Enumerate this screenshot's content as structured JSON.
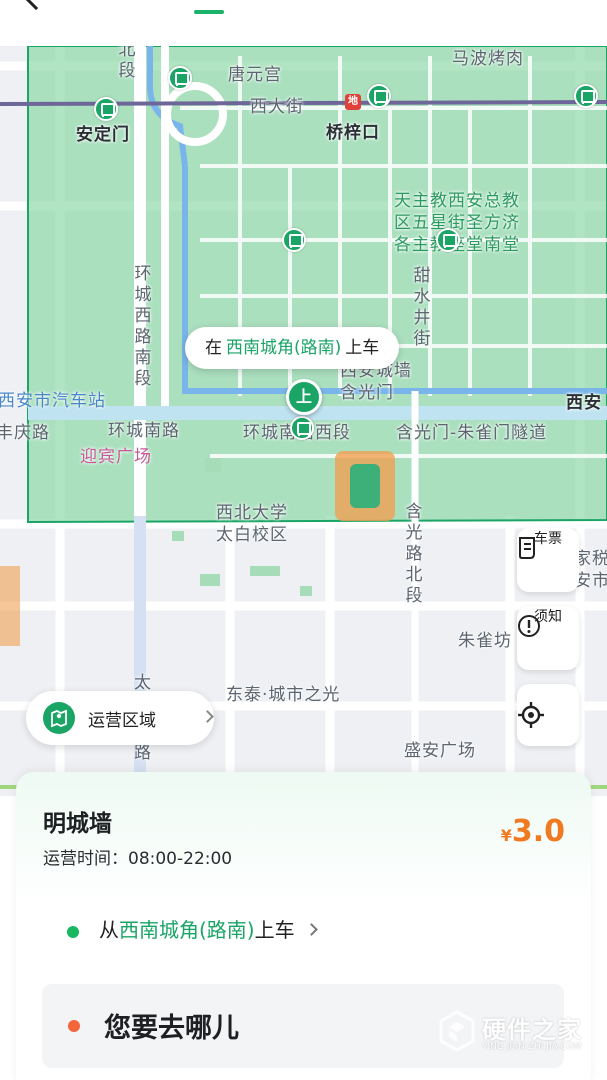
{
  "map": {
    "labels": {
      "bei_duan": "北段",
      "tang_yuan_gong": "唐元宫",
      "ma_bo_kao_rou": "马波烤肉",
      "xi_da_jie": "西大街",
      "an_ding_men": "安定门",
      "qiao_zi_kou": "桥梓口",
      "church_l1": "天主教西安总教",
      "church_l2": "区五星街圣方济",
      "church_l3": "各主教座堂南堂",
      "huan_cheng_xi_lu_nan_duan": "环城西路南段",
      "tian_shui_jing": "甜水井街",
      "xian_bus_station": "西安市汽车站",
      "feng_qing_lu": "丰庆路",
      "huan_cheng_nan_lu": "环城南路",
      "huan_cheng_nan_lu_xi_duan": "环城南路西段",
      "tunnel": "含光门-朱雀门隧道",
      "city_wall": "西安城墙",
      "han_guang_men": "含光门",
      "ying_bin_guang_chang": "迎宾广场",
      "nwu_l1": "西北大学",
      "nwu_l2": "太白校区",
      "han_guang_lu_bei_duan": "含光路北段",
      "zhu_que_fang": "朱雀坊",
      "dong_tai": "东泰·城市之光",
      "sheng_an": "盛安广场",
      "xi_an_right": "西安",
      "tax_right": "家税",
      "tax_right2": "安市",
      "tai": "太",
      "lu": "路"
    },
    "metro_glyph": "地",
    "boarding_bubble": {
      "prefix": "在",
      "station": "西南城角(路南)",
      "suffix": "上车"
    },
    "boarding_pin": "上",
    "controls": {
      "ticket_label": "车票",
      "notice_label": "须知",
      "ops_area_label": "运营区域"
    }
  },
  "sheet": {
    "route_title": "明城墙",
    "hours_label": "运营时间：",
    "hours_value": "08:00-22:00",
    "price_currency": "¥",
    "price_value": "3.0",
    "from_prefix": "从",
    "from_station": "西南城角(路南)",
    "from_suffix": "上车",
    "destination_placeholder": "您要去哪儿"
  },
  "watermark": {
    "main": "硬件之家",
    "sub": "YING JIAN ZHI JIA.COM"
  },
  "colors": {
    "brand_green": "#1aa466",
    "price_orange": "#f07a22",
    "dest_dot": "#f4663a",
    "area_fill": "#8fd8a8"
  }
}
